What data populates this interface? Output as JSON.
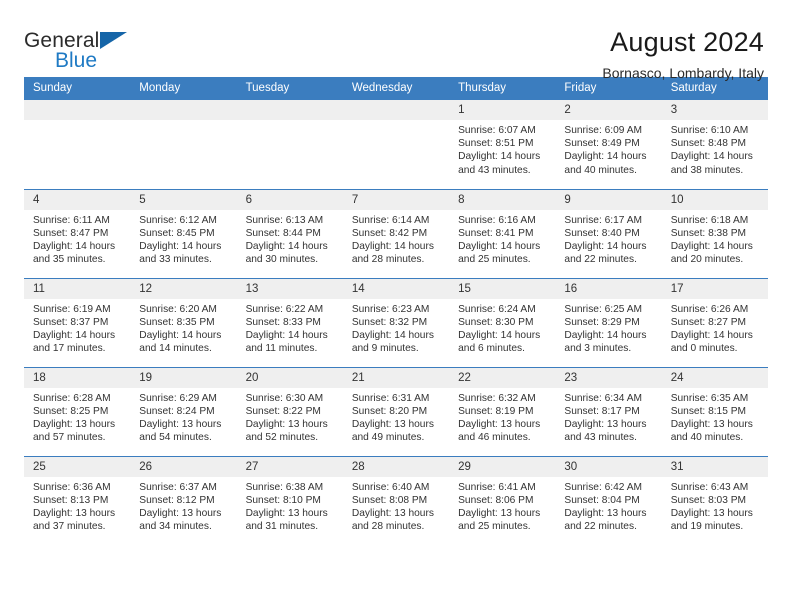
{
  "brand": {
    "name_part1": "General",
    "name_part2": "Blue",
    "triangle_color": "#1565a8",
    "blue_color": "#1f7ac4"
  },
  "header": {
    "title": "August 2024",
    "subtitle": "Bornasco, Lombardy, Italy",
    "header_bg": "#3b7dbf",
    "daynum_bg": "#efefef"
  },
  "weekday_headers": [
    "Sunday",
    "Monday",
    "Tuesday",
    "Wednesday",
    "Thursday",
    "Friday",
    "Saturday"
  ],
  "labels": {
    "sunrise": "Sunrise:",
    "sunset": "Sunset:",
    "daylight": "Daylight:"
  },
  "weeks": [
    [
      {
        "day": "",
        "empty": true
      },
      {
        "day": "",
        "empty": true
      },
      {
        "day": "",
        "empty": true
      },
      {
        "day": "",
        "empty": true
      },
      {
        "day": "1",
        "sunrise": "Sunrise: 6:07 AM",
        "sunset": "Sunset: 8:51 PM",
        "daylight_l1": "Daylight: 14 hours",
        "daylight_l2": "and 43 minutes."
      },
      {
        "day": "2",
        "sunrise": "Sunrise: 6:09 AM",
        "sunset": "Sunset: 8:49 PM",
        "daylight_l1": "Daylight: 14 hours",
        "daylight_l2": "and 40 minutes."
      },
      {
        "day": "3",
        "sunrise": "Sunrise: 6:10 AM",
        "sunset": "Sunset: 8:48 PM",
        "daylight_l1": "Daylight: 14 hours",
        "daylight_l2": "and 38 minutes."
      }
    ],
    [
      {
        "day": "4",
        "sunrise": "Sunrise: 6:11 AM",
        "sunset": "Sunset: 8:47 PM",
        "daylight_l1": "Daylight: 14 hours",
        "daylight_l2": "and 35 minutes."
      },
      {
        "day": "5",
        "sunrise": "Sunrise: 6:12 AM",
        "sunset": "Sunset: 8:45 PM",
        "daylight_l1": "Daylight: 14 hours",
        "daylight_l2": "and 33 minutes."
      },
      {
        "day": "6",
        "sunrise": "Sunrise: 6:13 AM",
        "sunset": "Sunset: 8:44 PM",
        "daylight_l1": "Daylight: 14 hours",
        "daylight_l2": "and 30 minutes."
      },
      {
        "day": "7",
        "sunrise": "Sunrise: 6:14 AM",
        "sunset": "Sunset: 8:42 PM",
        "daylight_l1": "Daylight: 14 hours",
        "daylight_l2": "and 28 minutes."
      },
      {
        "day": "8",
        "sunrise": "Sunrise: 6:16 AM",
        "sunset": "Sunset: 8:41 PM",
        "daylight_l1": "Daylight: 14 hours",
        "daylight_l2": "and 25 minutes."
      },
      {
        "day": "9",
        "sunrise": "Sunrise: 6:17 AM",
        "sunset": "Sunset: 8:40 PM",
        "daylight_l1": "Daylight: 14 hours",
        "daylight_l2": "and 22 minutes."
      },
      {
        "day": "10",
        "sunrise": "Sunrise: 6:18 AM",
        "sunset": "Sunset: 8:38 PM",
        "daylight_l1": "Daylight: 14 hours",
        "daylight_l2": "and 20 minutes."
      }
    ],
    [
      {
        "day": "11",
        "sunrise": "Sunrise: 6:19 AM",
        "sunset": "Sunset: 8:37 PM",
        "daylight_l1": "Daylight: 14 hours",
        "daylight_l2": "and 17 minutes."
      },
      {
        "day": "12",
        "sunrise": "Sunrise: 6:20 AM",
        "sunset": "Sunset: 8:35 PM",
        "daylight_l1": "Daylight: 14 hours",
        "daylight_l2": "and 14 minutes."
      },
      {
        "day": "13",
        "sunrise": "Sunrise: 6:22 AM",
        "sunset": "Sunset: 8:33 PM",
        "daylight_l1": "Daylight: 14 hours",
        "daylight_l2": "and 11 minutes."
      },
      {
        "day": "14",
        "sunrise": "Sunrise: 6:23 AM",
        "sunset": "Sunset: 8:32 PM",
        "daylight_l1": "Daylight: 14 hours",
        "daylight_l2": "and 9 minutes."
      },
      {
        "day": "15",
        "sunrise": "Sunrise: 6:24 AM",
        "sunset": "Sunset: 8:30 PM",
        "daylight_l1": "Daylight: 14 hours",
        "daylight_l2": "and 6 minutes."
      },
      {
        "day": "16",
        "sunrise": "Sunrise: 6:25 AM",
        "sunset": "Sunset: 8:29 PM",
        "daylight_l1": "Daylight: 14 hours",
        "daylight_l2": "and 3 minutes."
      },
      {
        "day": "17",
        "sunrise": "Sunrise: 6:26 AM",
        "sunset": "Sunset: 8:27 PM",
        "daylight_l1": "Daylight: 14 hours",
        "daylight_l2": "and 0 minutes."
      }
    ],
    [
      {
        "day": "18",
        "sunrise": "Sunrise: 6:28 AM",
        "sunset": "Sunset: 8:25 PM",
        "daylight_l1": "Daylight: 13 hours",
        "daylight_l2": "and 57 minutes."
      },
      {
        "day": "19",
        "sunrise": "Sunrise: 6:29 AM",
        "sunset": "Sunset: 8:24 PM",
        "daylight_l1": "Daylight: 13 hours",
        "daylight_l2": "and 54 minutes."
      },
      {
        "day": "20",
        "sunrise": "Sunrise: 6:30 AM",
        "sunset": "Sunset: 8:22 PM",
        "daylight_l1": "Daylight: 13 hours",
        "daylight_l2": "and 52 minutes."
      },
      {
        "day": "21",
        "sunrise": "Sunrise: 6:31 AM",
        "sunset": "Sunset: 8:20 PM",
        "daylight_l1": "Daylight: 13 hours",
        "daylight_l2": "and 49 minutes."
      },
      {
        "day": "22",
        "sunrise": "Sunrise: 6:32 AM",
        "sunset": "Sunset: 8:19 PM",
        "daylight_l1": "Daylight: 13 hours",
        "daylight_l2": "and 46 minutes."
      },
      {
        "day": "23",
        "sunrise": "Sunrise: 6:34 AM",
        "sunset": "Sunset: 8:17 PM",
        "daylight_l1": "Daylight: 13 hours",
        "daylight_l2": "and 43 minutes."
      },
      {
        "day": "24",
        "sunrise": "Sunrise: 6:35 AM",
        "sunset": "Sunset: 8:15 PM",
        "daylight_l1": "Daylight: 13 hours",
        "daylight_l2": "and 40 minutes."
      }
    ],
    [
      {
        "day": "25",
        "sunrise": "Sunrise: 6:36 AM",
        "sunset": "Sunset: 8:13 PM",
        "daylight_l1": "Daylight: 13 hours",
        "daylight_l2": "and 37 minutes."
      },
      {
        "day": "26",
        "sunrise": "Sunrise: 6:37 AM",
        "sunset": "Sunset: 8:12 PM",
        "daylight_l1": "Daylight: 13 hours",
        "daylight_l2": "and 34 minutes."
      },
      {
        "day": "27",
        "sunrise": "Sunrise: 6:38 AM",
        "sunset": "Sunset: 8:10 PM",
        "daylight_l1": "Daylight: 13 hours",
        "daylight_l2": "and 31 minutes."
      },
      {
        "day": "28",
        "sunrise": "Sunrise: 6:40 AM",
        "sunset": "Sunset: 8:08 PM",
        "daylight_l1": "Daylight: 13 hours",
        "daylight_l2": "and 28 minutes."
      },
      {
        "day": "29",
        "sunrise": "Sunrise: 6:41 AM",
        "sunset": "Sunset: 8:06 PM",
        "daylight_l1": "Daylight: 13 hours",
        "daylight_l2": "and 25 minutes."
      },
      {
        "day": "30",
        "sunrise": "Sunrise: 6:42 AM",
        "sunset": "Sunset: 8:04 PM",
        "daylight_l1": "Daylight: 13 hours",
        "daylight_l2": "and 22 minutes."
      },
      {
        "day": "31",
        "sunrise": "Sunrise: 6:43 AM",
        "sunset": "Sunset: 8:03 PM",
        "daylight_l1": "Daylight: 13 hours",
        "daylight_l2": "and 19 minutes."
      }
    ]
  ]
}
